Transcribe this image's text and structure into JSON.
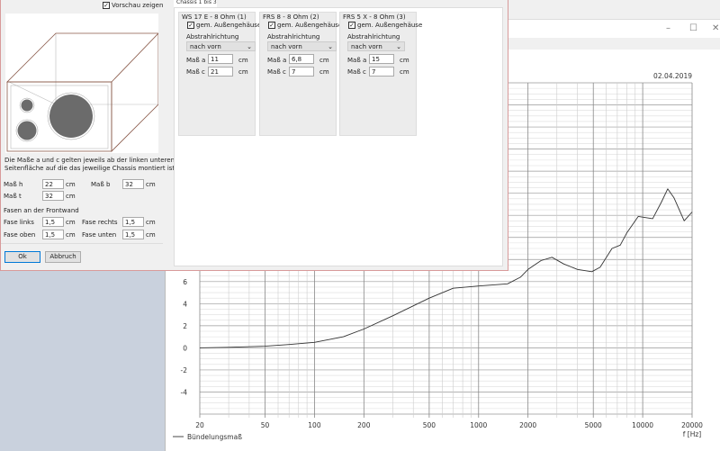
{
  "dialog": {
    "preview_checkbox": "Vorschau zeigen",
    "tab_label": "Chassis 1 bis 3",
    "info_text_line1": "Die Maße a und c gelten jeweils ab der linken unteren Ecke der",
    "info_text_line2": "Seitenfläche auf die das jeweilige Chassis montiert ist.",
    "dims": [
      {
        "label": "Maß h",
        "value": "22",
        "unit": "cm"
      },
      {
        "label": "Maß b",
        "value": "32",
        "unit": "cm"
      },
      {
        "label": "Maß t",
        "value": "32",
        "unit": "cm"
      }
    ],
    "bevel_heading": "Fasen an der Frontwand",
    "bevels": [
      {
        "label": "Fase links",
        "value": "1,5",
        "unit": "cm"
      },
      {
        "label": "Fase rechts",
        "value": "1,5",
        "unit": "cm"
      },
      {
        "label": "Fase oben",
        "value": "1,5",
        "unit": "cm"
      },
      {
        "label": "Fase unten",
        "value": "1,5",
        "unit": "cm"
      }
    ],
    "ok": "Ok",
    "cancel": "Abbruch",
    "chassis": [
      {
        "title": "WS 17 E - 8 Ohm   (1)",
        "checkbox": "gem. Außengehäuse",
        "dir_label": "Abstrahlrichtung",
        "dir": "nach vorn",
        "a_label": "Maß a",
        "a": "11",
        "c_label": "Maß c",
        "c": "21",
        "unit": "cm"
      },
      {
        "title": "FRS 8 - 8 Ohm (2)",
        "checkbox": "gem. Außengehäuse",
        "dir_label": "Abstrahlrichtung",
        "dir": "nach vorn",
        "a_label": "Maß a",
        "a": "6,8",
        "c_label": "Maß c",
        "c": "7",
        "unit": "cm"
      },
      {
        "title": "FRS 5 X - 8 Ohm (3)",
        "checkbox": "gem. Außengehäuse",
        "dir_label": "Abstrahlrichtung",
        "dir": "nach vorn",
        "a_label": "Maß a",
        "a": "15",
        "c_label": "Maß c",
        "c": "7",
        "unit": "cm"
      }
    ]
  },
  "window": {
    "minimize": "–",
    "maximize": "☐",
    "close": "✕"
  },
  "chart_data": {
    "type": "line",
    "date": "02.04.2019",
    "xlabel": "f [Hz]",
    "xscale": "log",
    "xlim": [
      20,
      20000
    ],
    "xticks": [
      20,
      50,
      100,
      200,
      500,
      1000,
      2000,
      5000,
      10000,
      20000
    ],
    "ylim": [
      -6,
      24
    ],
    "yticks": [
      -4,
      -2,
      0,
      2,
      4,
      6
    ],
    "grid": true,
    "legend": "bottom-left",
    "series": [
      {
        "name": "Bündelungsmaß",
        "color": "#333333",
        "x": [
          20,
          30,
          50,
          70,
          100,
          150,
          200,
          300,
          500,
          700,
          1000,
          1500,
          1800,
          2000,
          2400,
          2800,
          3300,
          4000,
          4900,
          5500,
          6500,
          7300,
          8000,
          9400,
          11500,
          13000,
          14200,
          15500,
          17900,
          20000
        ],
        "y": [
          0,
          0.05,
          0.15,
          0.3,
          0.5,
          1.0,
          1.7,
          2.9,
          4.5,
          5.4,
          5.6,
          5.8,
          6.4,
          7.1,
          7.9,
          8.2,
          7.6,
          7.1,
          6.9,
          7.3,
          9.0,
          9.3,
          10.4,
          11.9,
          11.7,
          13.2,
          14.4,
          13.6,
          11.5,
          12.3
        ]
      }
    ]
  }
}
